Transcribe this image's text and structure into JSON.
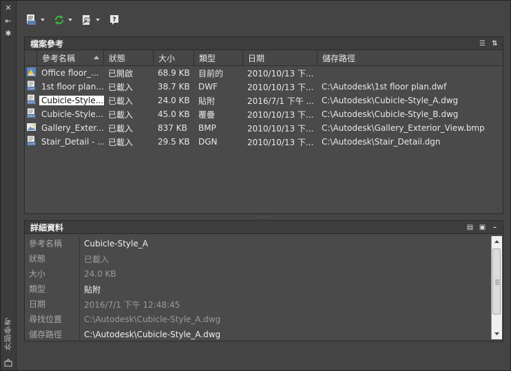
{
  "palette": {
    "title": "外部參考"
  },
  "files_panel": {
    "title": "檔案參考",
    "columns": [
      "參考名稱",
      "狀態",
      "大小",
      "類型",
      "日期",
      "儲存路徑"
    ],
    "rows": [
      {
        "icon": "dwg-drawing-icon",
        "name": "Office floor_...",
        "status": "已開啟",
        "size": "68.9 KB",
        "type": "目前的",
        "date": "2010/10/13 下...",
        "path": ""
      },
      {
        "icon": "dwf-file-icon",
        "name": "1st floor plan...",
        "status": "已載入",
        "size": "38.7 KB",
        "type": "DWF",
        "date": "2010/10/13 下...",
        "path": "C:\\Autodesk\\1st floor plan.dwf"
      },
      {
        "icon": "dwg-file-icon",
        "name": "Cubicle-Style...",
        "status": "已載入",
        "size": "24.0 KB",
        "type": "貼附",
        "date": "2016/7/1 下午 ...",
        "path": "C:\\Autodesk\\Cubicle-Style_A.dwg",
        "selected": true
      },
      {
        "icon": "dwg-file-icon",
        "name": "Cubicle-Style...",
        "status": "已載入",
        "size": "45.0 KB",
        "type": "覆疊",
        "date": "2010/10/13 下...",
        "path": "C:\\Autodesk\\Cubicle-Style_B.dwg"
      },
      {
        "icon": "image-file-icon",
        "name": "Gallery_Exter...",
        "status": "已載入",
        "size": "837 KB",
        "type": "BMP",
        "date": "2010/10/13 下...",
        "path": "C:\\Autodesk\\Gallery_Exterior_View.bmp"
      },
      {
        "icon": "dgn-file-icon",
        "name": "Stair_Detail - ...",
        "status": "已載入",
        "size": "29.5 KB",
        "type": "DGN",
        "date": "2010/10/13 下...",
        "path": "C:\\Autodesk\\Stair_Detail.dgn"
      }
    ]
  },
  "details_panel": {
    "title": "詳細資料",
    "rows": [
      {
        "label": "參考名稱",
        "value": "Cubicle-Style_A",
        "dim": false
      },
      {
        "label": "狀態",
        "value": "已載入",
        "dim": true
      },
      {
        "label": "大小",
        "value": "24.0 KB",
        "dim": true
      },
      {
        "label": "類型",
        "value": "貼附",
        "dim": false
      },
      {
        "label": "日期",
        "value": "2016/7/1 下午 12:48:45",
        "dim": true
      },
      {
        "label": "尋找位置",
        "value": "C:\\Autodesk\\Cubicle-Style_A.dwg",
        "dim": true
      },
      {
        "label": "儲存路徑",
        "value": "C:\\Autodesk\\Cubicle-Style_A.dwg",
        "dim": false
      }
    ]
  },
  "colors": {
    "selected_bg": "#ffffff",
    "refresh_green": "#3cb043"
  }
}
